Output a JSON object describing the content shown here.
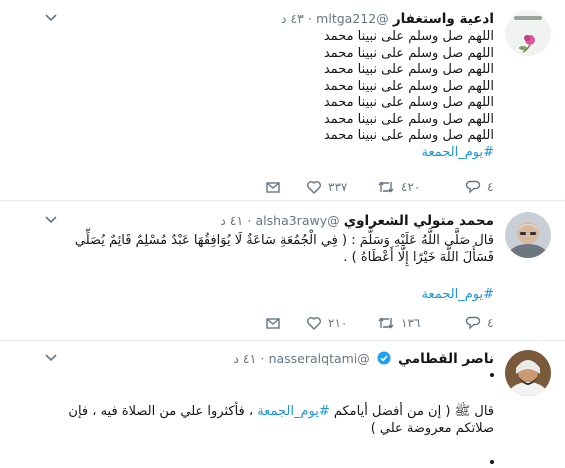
{
  "tweets": [
    {
      "name": "ادعية واستغفار",
      "handle": "@mltga212",
      "time": "٤٣ د",
      "lines": [
        "اللهم صل وسلم على نبينا محمد",
        "اللهم صل وسلم على نبينا محمد",
        "اللهم صل وسلم على نبينا محمد",
        "اللهم صل وسلم على نبينا محمد",
        "اللهم صل وسلم على نبينا محمد",
        "اللهم صل وسلم على نبينا محمد",
        "اللهم صل وسلم على نبينا محمد"
      ],
      "hashtag": "#يوم_الجمعة",
      "replies": "٤",
      "retweets": "٤٢٠",
      "likes": "٣٣٧"
    },
    {
      "name": "محمد متولي الشعراوي",
      "handle": "@alsha3rawy",
      "time": "٤١ د",
      "text": "قال صَلَّى اللَّهُ عَلَيْهِ وَسَلَّمَ : ( فِي الْجُمُعَةِ سَاعَةٌ لَا يُوَافِقُهَا عَبْدٌ مُسْلِمٌ قَائِمٌ يُصَلِّي فَسَأَلَ اللَّهَ خَيْرًا إِلَّا أَعْطَاهُ ) .",
      "hashtag": "#يوم_الجمعة",
      "replies": "٤",
      "retweets": "١٣٦",
      "likes": "٢١٠"
    },
    {
      "name": "ناصر القطامي",
      "handle": "@nasseralqtami",
      "time": "٤١ د",
      "text_before": "قال ﷺ ( إن من أفضل أيامكم ",
      "hashtag": "#يوم_الجمعة",
      "text_after": " ، فأكثروا علي من الصلاة فيه ، فإن صلاتكم معروضة علي )"
    }
  ],
  "dot": "·",
  "colors": {
    "accent": "#1b95e0",
    "secondary": "#657786",
    "text": "#14171a",
    "divider": "#e6ecf0"
  },
  "icons": [
    "chevron-down-icon",
    "reply-icon",
    "retweet-icon",
    "like-icon",
    "message-icon",
    "verified-icon"
  ]
}
